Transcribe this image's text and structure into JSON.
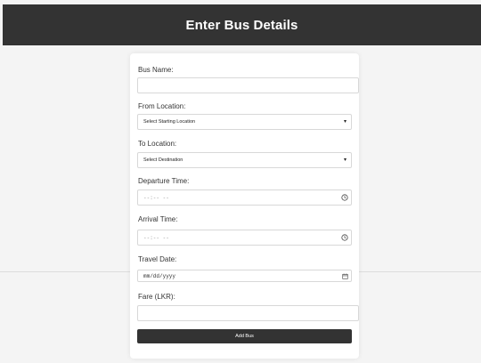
{
  "header": {
    "title": "Enter Bus Details"
  },
  "form": {
    "bus_name": {
      "label": "Bus Name:",
      "value": ""
    },
    "from_location": {
      "label": "From Location:",
      "selected": "Select Starting Location"
    },
    "to_location": {
      "label": "To Location:",
      "selected": "Select Destination"
    },
    "departure_time": {
      "label": "Departure Time:",
      "placeholder": "--:-- --"
    },
    "arrival_time": {
      "label": "Arrival Time:",
      "placeholder": "--:-- --"
    },
    "travel_date": {
      "label": "Travel Date:",
      "placeholder": "mm/dd/yyyy"
    },
    "fare": {
      "label": "Fare (LKR):",
      "value": ""
    },
    "submit_label": "Add Bus"
  },
  "icons": {
    "select_arrow": "chevron-down-icon",
    "time": "clock-icon",
    "date": "calendar-icon"
  },
  "colors": {
    "header_bg": "#333333",
    "button_bg": "#333333",
    "page_bg": "#f4f4f4"
  }
}
